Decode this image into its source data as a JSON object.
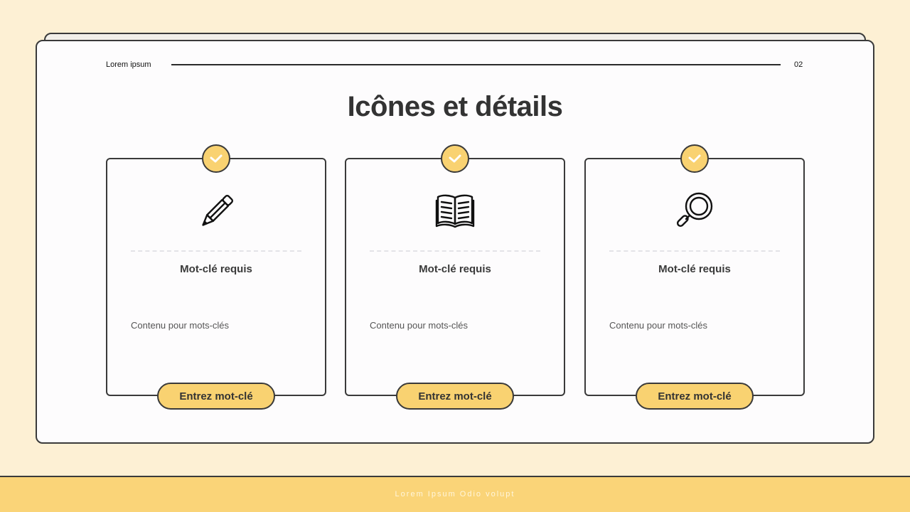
{
  "header": {
    "left_label": "Lorem ipsum",
    "page_number": "02"
  },
  "title": "Icônes et détails",
  "cards": [
    {
      "icon": "pencil-icon",
      "heading": "Mot-clé requis",
      "body": "Contenu pour mots-clés",
      "button_label": "Entrez mot-clé"
    },
    {
      "icon": "book-icon",
      "heading": "Mot-clé requis",
      "body": "Contenu pour mots-clés",
      "button_label": "Entrez mot-clé"
    },
    {
      "icon": "magnifier-icon",
      "heading": "Mot-clé requis",
      "body": "Contenu pour mots-clés",
      "button_label": "Entrez mot-clé"
    }
  ],
  "footer": {
    "text": "Lorem Ipsum Odio volupt"
  },
  "colors": {
    "background": "#fdf0d4",
    "accent": "#f9d271",
    "footer": "#fad478",
    "outline": "#3a3a3a",
    "title": "#333333"
  }
}
